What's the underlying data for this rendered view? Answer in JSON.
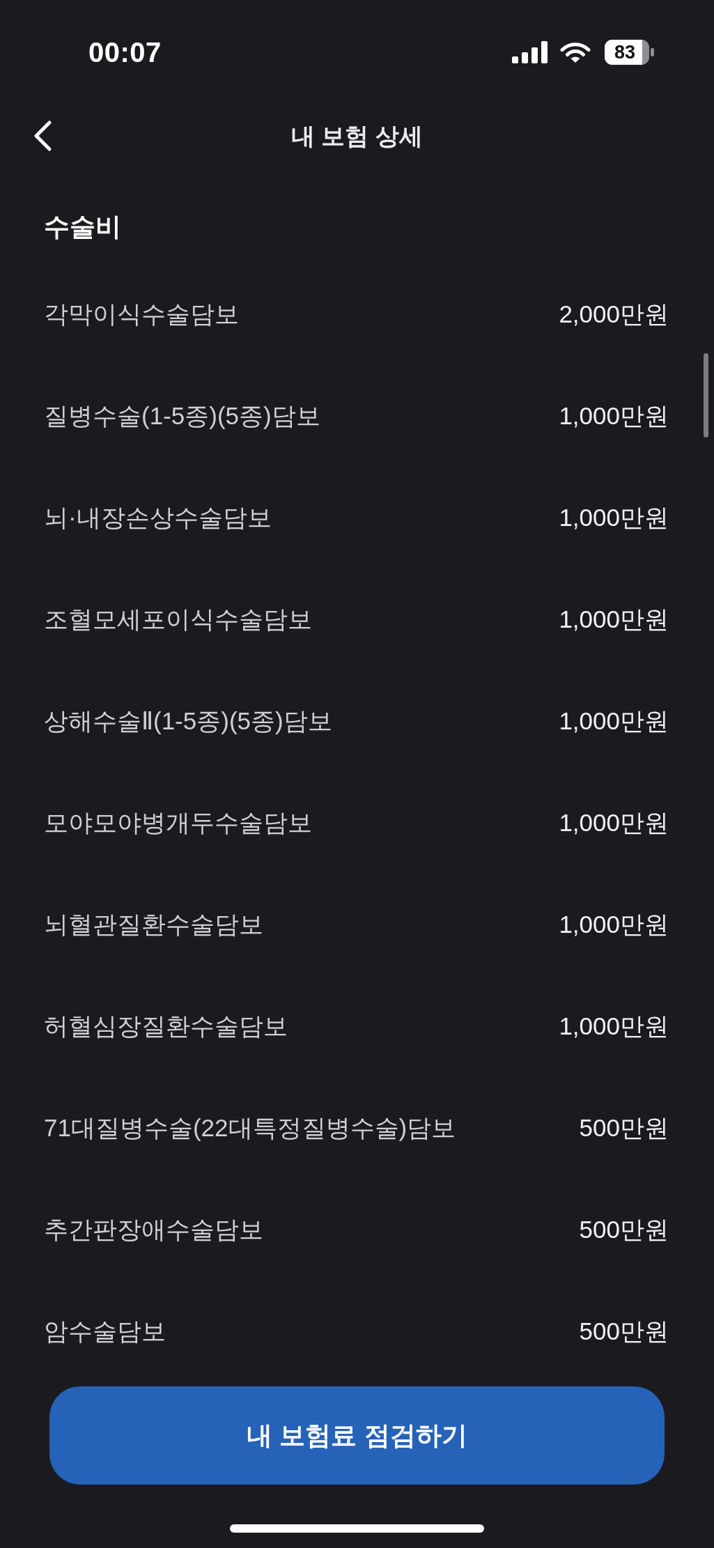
{
  "status_bar": {
    "time": "00:07",
    "battery": "83"
  },
  "header": {
    "title": "내 보험 상세"
  },
  "section": {
    "title": "수술비",
    "rows": [
      {
        "label": "각막이식수술담보",
        "value": "2,000만원"
      },
      {
        "label": "질병수술(1-5종)(5종)담보",
        "value": "1,000만원"
      },
      {
        "label": "뇌·내장손상수술담보",
        "value": "1,000만원"
      },
      {
        "label": "조혈모세포이식수술담보",
        "value": "1,000만원"
      },
      {
        "label": "상해수술Ⅱ(1-5종)(5종)담보",
        "value": "1,000만원"
      },
      {
        "label": "모야모야병개두수술담보",
        "value": "1,000만원"
      },
      {
        "label": "뇌혈관질환수술담보",
        "value": "1,000만원"
      },
      {
        "label": "허혈심장질환수술담보",
        "value": "1,000만원"
      },
      {
        "label": "71대질병수술(22대특정질병수술)담보",
        "value": "500만원"
      },
      {
        "label": "추간판장애수술담보",
        "value": "500만원"
      },
      {
        "label": "암수술담보",
        "value": "500만원"
      }
    ]
  },
  "button": {
    "label": "내 보험료 점검하기"
  }
}
